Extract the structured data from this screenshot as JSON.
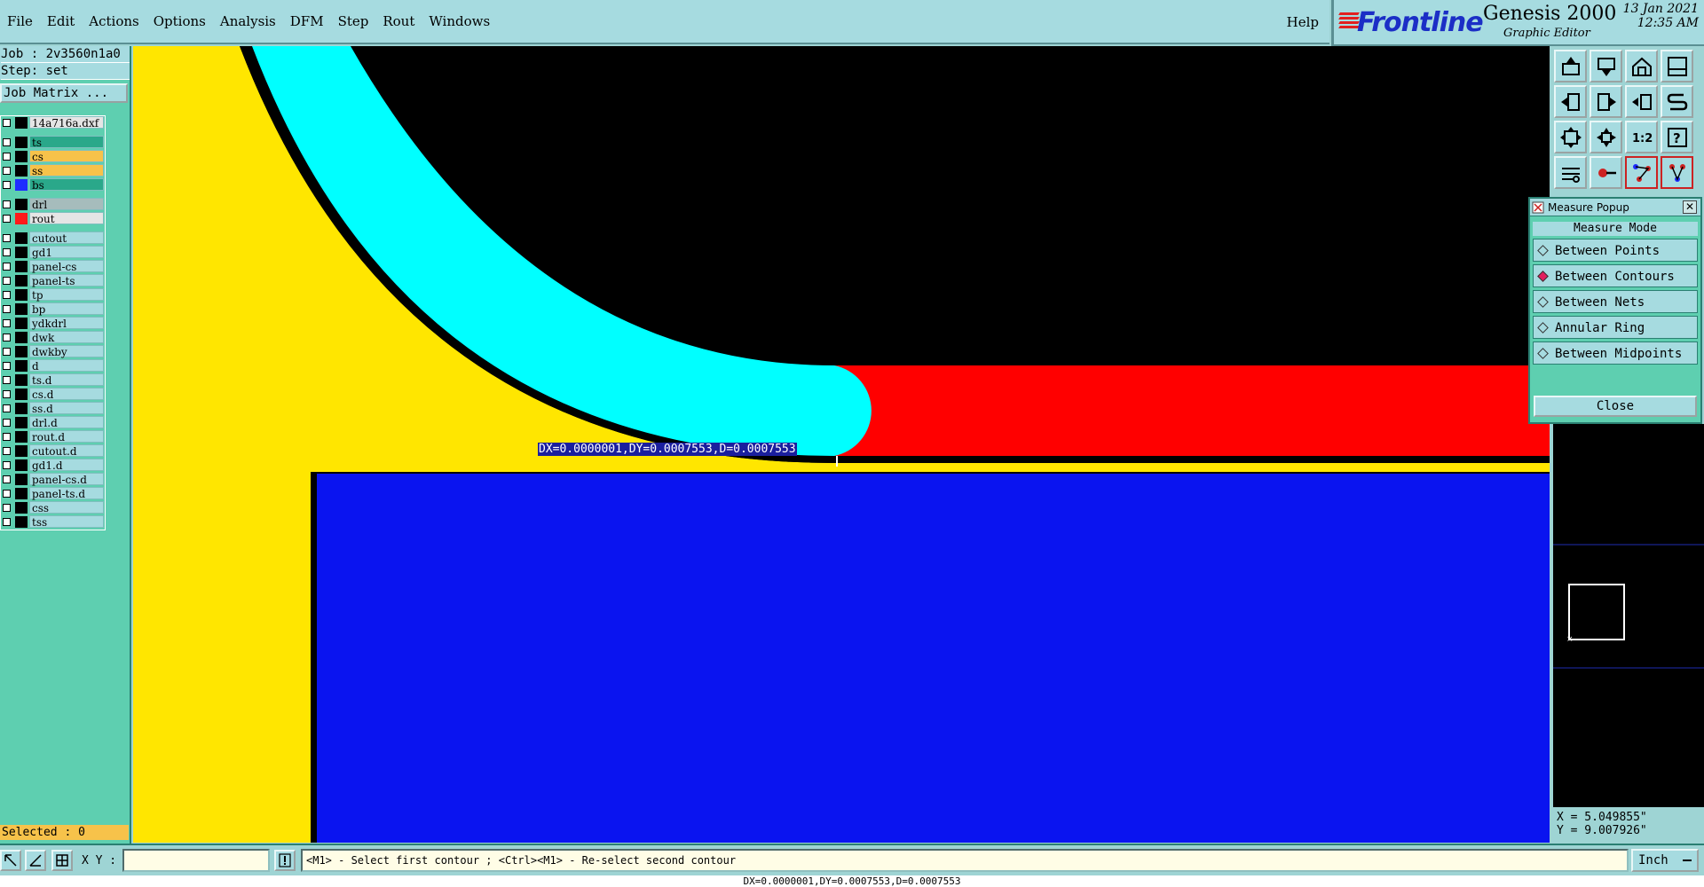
{
  "menubar": {
    "items": [
      "File",
      "Edit",
      "Actions",
      "Options",
      "Analysis",
      "DFM",
      "Step",
      "Rout",
      "Windows"
    ],
    "help": "Help"
  },
  "brand": {
    "logo": "Frontline",
    "product": "Genesis 2000",
    "subtitle": "Graphic Editor",
    "date": "13 Jan 2021",
    "time": "12:35 AM"
  },
  "job": {
    "job_line": "Job : 2v3560n1a0",
    "step_line": "Step: set",
    "matrix_button": "Job Matrix ..."
  },
  "layers": {
    "file": {
      "name": "14a716a.dxf"
    },
    "board": [
      {
        "name": "ts",
        "color": "#2aa88a"
      },
      {
        "name": "cs",
        "color": "#f7c24a"
      },
      {
        "name": "ss",
        "color": "#f7c24a"
      },
      {
        "name": "bs",
        "color": "#2aa88a",
        "swatch": "#1e2cff"
      }
    ],
    "drill": [
      {
        "name": "drl",
        "color": "#a6bcbc"
      },
      {
        "name": "rout",
        "color": "#e5e5e5",
        "swatch": "#ff1a1a"
      }
    ],
    "misc": [
      "cutout",
      "gd1",
      "panel-cs",
      "panel-ts",
      "tp",
      "bp",
      "ydkdrl",
      "dwk",
      "dwkby",
      "d",
      "ts.d",
      "cs.d",
      "ss.d",
      "drl.d",
      "rout.d",
      "cutout.d",
      "gd1.d",
      "panel-cs.d",
      "panel-ts.d",
      "css",
      "tss"
    ]
  },
  "selected": "Selected : 0",
  "canvas": {
    "measure_text": "DX=0.0000001,DY=0.0007553,D=0.0007553",
    "colors": {
      "yellow": "#ffe600",
      "cyan": "#00ffff",
      "red": "#ff0000",
      "blue": "#0a14f0",
      "black": "#000000"
    }
  },
  "measure_popup": {
    "title": "Measure Popup",
    "header": "Measure Mode",
    "options": [
      {
        "label": "Between Points",
        "selected": false
      },
      {
        "label": "Between Contours",
        "selected": true
      },
      {
        "label": "Between Nets",
        "selected": false
      },
      {
        "label": "Annular Ring",
        "selected": false
      },
      {
        "label": "Between Midpoints",
        "selected": false
      }
    ],
    "close": "Close"
  },
  "coords": {
    "x": "X = 5.049855\"",
    "y": "Y = 9.007926\""
  },
  "bottom": {
    "xy_label": "X Y :",
    "xy_value": "",
    "message": "<M1> - Select first contour ; <Ctrl><M1> - Re-select second contour",
    "units": "Inch",
    "status": "DX=0.0000001,DY=0.0007553,D=0.0007553"
  }
}
